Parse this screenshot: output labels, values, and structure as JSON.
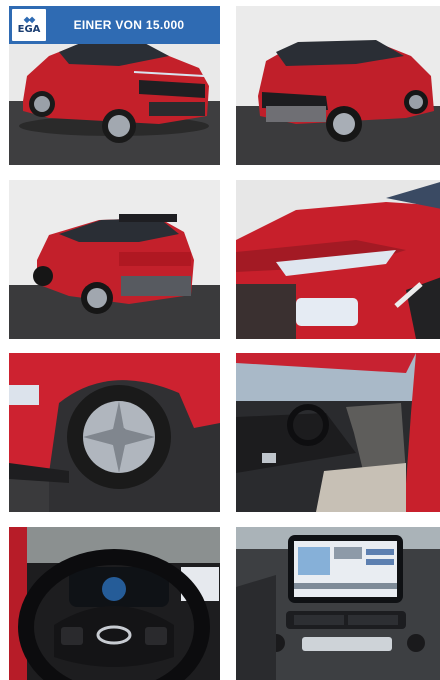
{
  "gallery": {
    "banner": {
      "logo_text": "EGA",
      "logo_mark": "◆◆",
      "text": "EINER VON 15.000"
    },
    "images": [
      {
        "alt": "red-suv-front-left-view"
      },
      {
        "alt": "red-suv-rear-right-view"
      },
      {
        "alt": "red-suv-rear-left-view"
      },
      {
        "alt": "headlight-closeup"
      },
      {
        "alt": "wheel-closeup"
      },
      {
        "alt": "interior-front-seats"
      },
      {
        "alt": "steering-wheel"
      },
      {
        "alt": "infotainment-display"
      }
    ]
  }
}
